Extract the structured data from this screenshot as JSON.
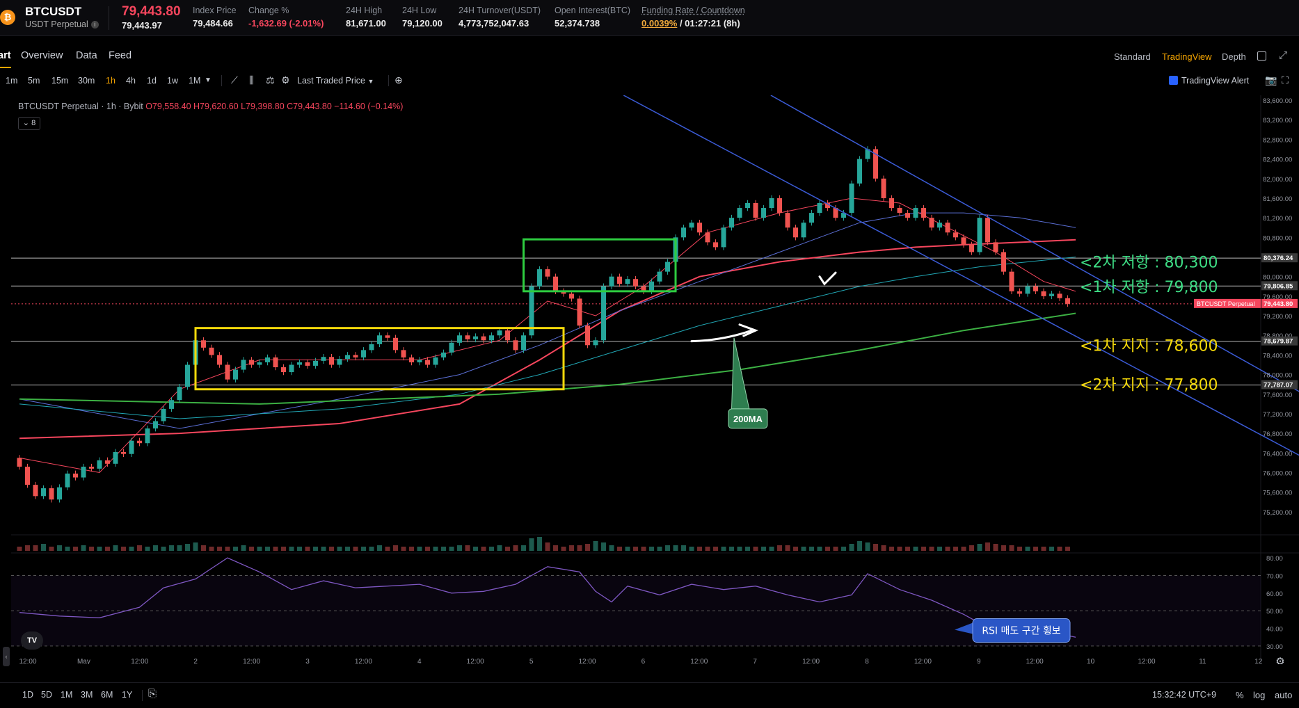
{
  "ticker": {
    "coin_icon": "bitcoin-icon",
    "symbol": "BTCUSDT",
    "contract_type": "USDT Perpetual",
    "last_price": "79,443.80",
    "mark_price": "79,443.97",
    "stats": [
      {
        "label": "Index Price",
        "value": "79,484.66",
        "tone": "normal"
      },
      {
        "label": "Change %",
        "value": "-1,632.69 (-2.01%)",
        "tone": "negative"
      },
      {
        "label": "24H High",
        "value": "81,671.00",
        "tone": "normal"
      },
      {
        "label": "24H Low",
        "value": "79,120.00",
        "tone": "normal"
      },
      {
        "label": "24H Turnover(USDT)",
        "value": "4,773,752,047.63",
        "tone": "normal"
      },
      {
        "label": "Open Interest(BTC)",
        "value": "52,374.738",
        "tone": "normal"
      }
    ],
    "funding": {
      "label": "Funding Rate / Countdown",
      "rate": "0.0039%",
      "countdown": "/ 01:27:21 (8h)"
    }
  },
  "nav": {
    "tabs": [
      "art",
      "Overview",
      "Data",
      "Feed"
    ],
    "views": [
      "Standard",
      "TradingView",
      "Depth"
    ],
    "active_view": "TradingView"
  },
  "toolbar": {
    "timeframes": [
      "1m",
      "5m",
      "15m",
      "30m",
      "1h",
      "4h",
      "1d",
      "1w",
      "1M"
    ],
    "active_timeframe": "1h",
    "price_source": "Last Traded Price",
    "alert_label": "TradingView Alert"
  },
  "legend": {
    "title": "BTCUSDT Perpetual · 1h · Bybit",
    "ohlc": "O79,558.40 H79,620.60 L79,398.80 C79,443.80 −114.60 (−0.14%)",
    "collapse_count": "8"
  },
  "chart_data": {
    "type": "candlestick",
    "price_axis": {
      "ylim": [
        74900,
        83700
      ],
      "ticks": [
        "83,600.00",
        "83,200.00",
        "82,800.00",
        "82,400.00",
        "82,000.00",
        "81,600.00",
        "81,200.00",
        "80,800.00",
        "80,400.00",
        "80,000.00",
        "79,600.00",
        "79,200.00",
        "78,800.00",
        "78,400.00",
        "78,000.00",
        "77,600.00",
        "77,200.00",
        "76,800.00",
        "76,400.00",
        "76,000.00",
        "75,600.00",
        "75,200.00"
      ]
    },
    "price_labels": [
      {
        "text": "80,376.24",
        "value": 80376.24,
        "color": "#3a3a3a"
      },
      {
        "text": "79,806.85",
        "value": 79806.85,
        "color": "#3a3a3a"
      },
      {
        "text": "79,443.80",
        "value": 79443.8,
        "color": "#f6465d",
        "tag": "BTCUSDT Perpetual"
      },
      {
        "text": "78,679.87",
        "value": 78679.87,
        "color": "#3a3a3a"
      },
      {
        "text": "77,787.07",
        "value": 77787.07,
        "color": "#3a3a3a"
      }
    ],
    "x_axis": {
      "start": "Apr 30 08:00",
      "bar_interval_hours": 1,
      "ticks": [
        "12:00",
        "May",
        "12:00",
        "2",
        "12:00",
        "3",
        "12:00",
        "4",
        "12:00",
        "5",
        "12:00",
        "6",
        "12:00",
        "7",
        "12:00",
        "8",
        "12:00",
        "9",
        "12:00",
        "10",
        "12:00",
        "11",
        "12"
      ]
    },
    "candles": [
      [
        76300,
        76120
      ],
      [
        76120,
        75750
      ],
      [
        75750,
        75520
      ],
      [
        75520,
        75680
      ],
      [
        75680,
        75450
      ],
      [
        75450,
        75700
      ],
      [
        75700,
        75980
      ],
      [
        75980,
        75900
      ],
      [
        75900,
        76120
      ],
      [
        76120,
        76080
      ],
      [
        76080,
        76250
      ],
      [
        76250,
        76180
      ],
      [
        76180,
        76420
      ],
      [
        76420,
        76380
      ],
      [
        76380,
        76650
      ],
      [
        76650,
        76600
      ],
      [
        76600,
        76900
      ],
      [
        76900,
        77050
      ],
      [
        77050,
        77300
      ],
      [
        77300,
        77480
      ],
      [
        77480,
        77750
      ],
      [
        77750,
        78200
      ],
      [
        78200,
        78700
      ],
      [
        78700,
        78550
      ],
      [
        78550,
        78400
      ],
      [
        78400,
        78200
      ],
      [
        78200,
        77900
      ],
      [
        77900,
        78100
      ],
      [
        78100,
        78300
      ],
      [
        78300,
        78200
      ],
      [
        78200,
        78250
      ],
      [
        78250,
        78350
      ],
      [
        78350,
        78150
      ],
      [
        78150,
        78050
      ],
      [
        78050,
        78200
      ],
      [
        78200,
        78250
      ],
      [
        78250,
        78180
      ],
      [
        78180,
        78280
      ],
      [
        78280,
        78360
      ],
      [
        78360,
        78200
      ],
      [
        78200,
        78320
      ],
      [
        78320,
        78400
      ],
      [
        78400,
        78350
      ],
      [
        78350,
        78500
      ],
      [
        78500,
        78620
      ],
      [
        78620,
        78800
      ],
      [
        78800,
        78750
      ],
      [
        78750,
        78500
      ],
      [
        78500,
        78350
      ],
      [
        78350,
        78250
      ],
      [
        78250,
        78300
      ],
      [
        78300,
        78200
      ],
      [
        78200,
        78350
      ],
      [
        78350,
        78450
      ],
      [
        78450,
        78650
      ],
      [
        78650,
        78800
      ],
      [
        78800,
        78720
      ],
      [
        78720,
        78780
      ],
      [
        78780,
        78700
      ],
      [
        78700,
        78800
      ],
      [
        78800,
        78900
      ],
      [
        78900,
        78700
      ],
      [
        78700,
        78500
      ],
      [
        78500,
        78800
      ],
      [
        78800,
        79800
      ],
      [
        79800,
        80150
      ],
      [
        80150,
        80000
      ],
      [
        80000,
        79700
      ],
      [
        79700,
        79650
      ],
      [
        79650,
        79550
      ],
      [
        79550,
        79000
      ],
      [
        79000,
        78600
      ],
      [
        78600,
        78700
      ],
      [
        78700,
        79800
      ],
      [
        79800,
        80000
      ],
      [
        80000,
        79850
      ],
      [
        79850,
        79950
      ],
      [
        79950,
        79800
      ],
      [
        79800,
        79700
      ],
      [
        79700,
        79900
      ],
      [
        79900,
        80100
      ],
      [
        80100,
        80300
      ],
      [
        80300,
        80800
      ],
      [
        80800,
        81000
      ],
      [
        81000,
        81100
      ],
      [
        81100,
        80900
      ],
      [
        80900,
        80700
      ],
      [
        80700,
        80600
      ],
      [
        80600,
        81000
      ],
      [
        81000,
        81200
      ],
      [
        81200,
        81400
      ],
      [
        81400,
        81500
      ],
      [
        81500,
        81200
      ],
      [
        81200,
        81400
      ],
      [
        81400,
        81600
      ],
      [
        81600,
        81300
      ],
      [
        81300,
        81000
      ],
      [
        81000,
        80800
      ],
      [
        80800,
        81100
      ],
      [
        81100,
        81300
      ],
      [
        81300,
        81500
      ],
      [
        81500,
        81400
      ],
      [
        81400,
        81200
      ],
      [
        81200,
        81300
      ],
      [
        81300,
        81900
      ],
      [
        81900,
        82400
      ],
      [
        82400,
        82600
      ],
      [
        82600,
        82000
      ],
      [
        82000,
        81600
      ],
      [
        81600,
        81400
      ],
      [
        81400,
        81300
      ],
      [
        81300,
        81200
      ],
      [
        81200,
        81400
      ],
      [
        81400,
        81200
      ],
      [
        81200,
        81000
      ],
      [
        81000,
        81100
      ],
      [
        81100,
        80900
      ],
      [
        80900,
        80800
      ],
      [
        80800,
        80650
      ],
      [
        80650,
        80500
      ],
      [
        80500,
        81200
      ],
      [
        81200,
        80700
      ],
      [
        80700,
        80500
      ],
      [
        80500,
        80100
      ],
      [
        80100,
        79700
      ],
      [
        79700,
        79650
      ],
      [
        79650,
        79800
      ],
      [
        79800,
        79700
      ],
      [
        79700,
        79600
      ],
      [
        79600,
        79650
      ],
      [
        79650,
        79560
      ],
      [
        79560,
        79443.8
      ]
    ],
    "moving_averages": [
      {
        "name": "",
        "color": "#f6465d",
        "width": 2,
        "points": [
          [
            0,
            76700
          ],
          [
            20,
            76800
          ],
          [
            40,
            77000
          ],
          [
            55,
            77400
          ],
          [
            65,
            78300
          ],
          [
            75,
            79300
          ],
          [
            85,
            80000
          ],
          [
            95,
            80300
          ],
          [
            105,
            80500
          ],
          [
            112,
            80600
          ],
          [
            118,
            80650
          ],
          [
            125,
            80700
          ],
          [
            132,
            80750
          ]
        ]
      },
      {
        "name": "",
        "color": "#5b6fd6",
        "width": 1,
        "points": [
          [
            0,
            77500
          ],
          [
            20,
            76900
          ],
          [
            40,
            77500
          ],
          [
            55,
            78000
          ],
          [
            65,
            78600
          ],
          [
            75,
            79300
          ],
          [
            85,
            79900
          ],
          [
            95,
            80500
          ],
          [
            105,
            81100
          ],
          [
            112,
            81300
          ],
          [
            118,
            81300
          ],
          [
            125,
            81200
          ],
          [
            132,
            81000
          ]
        ]
      },
      {
        "name": "",
        "color": "#21a7b5",
        "width": 1,
        "points": [
          [
            0,
            77400
          ],
          [
            20,
            77100
          ],
          [
            40,
            77300
          ],
          [
            55,
            77600
          ],
          [
            65,
            78000
          ],
          [
            75,
            78500
          ],
          [
            85,
            79000
          ],
          [
            95,
            79400
          ],
          [
            105,
            79800
          ],
          [
            112,
            80000
          ],
          [
            120,
            80200
          ],
          [
            132,
            80400
          ]
        ]
      },
      {
        "name": "",
        "color": "#f6465d",
        "width": 1,
        "points": [
          [
            0,
            76300
          ],
          [
            10,
            76000
          ],
          [
            20,
            77700
          ],
          [
            30,
            78300
          ],
          [
            40,
            78300
          ],
          [
            50,
            78300
          ],
          [
            60,
            78700
          ],
          [
            66,
            79500
          ],
          [
            72,
            79200
          ],
          [
            78,
            79800
          ],
          [
            86,
            80900
          ],
          [
            95,
            81300
          ],
          [
            104,
            81600
          ],
          [
            110,
            81500
          ],
          [
            116,
            81000
          ],
          [
            122,
            80500
          ],
          [
            128,
            79900
          ],
          [
            132,
            79700
          ]
        ]
      },
      {
        "name": "",
        "color": "#3cb043",
        "width": 2,
        "points": [
          [
            0,
            77500
          ],
          [
            30,
            77400
          ],
          [
            60,
            77600
          ],
          [
            75,
            77800
          ],
          [
            90,
            78100
          ],
          [
            105,
            78500
          ],
          [
            118,
            78900
          ],
          [
            132,
            79250
          ]
        ]
      }
    ],
    "horizontal_levels": [
      80376.24,
      79806.85,
      78679.87,
      77787.07
    ],
    "trend_lines": [
      {
        "color": "#3b5bd6",
        "from": [
          75.5,
          83700
        ],
        "to": [
          175.5,
          75000
        ]
      },
      {
        "color": "#3b5bd6",
        "from": [
          93.9,
          83700
        ],
        "to": [
          178,
          76000
        ]
      }
    ],
    "annotations": {
      "levels": [
        {
          "text": "<2차 저항 : 80,300",
          "value": 80300,
          "color": "#3ddc84"
        },
        {
          "text": "<1차 저항 : 79,800",
          "value": 79800,
          "color": "#3ddc84"
        },
        {
          "text": "<1차 지지 : 78,600",
          "value": 78600,
          "color": "#f5d90a"
        },
        {
          "text": "<2차 지지 : 77,800",
          "value": 77800,
          "color": "#f5d90a"
        }
      ],
      "callout_ma": "200MA",
      "callout_rsi": "RSI 매도 구간 횡보",
      "boxes": [
        {
          "color": "#f5d90a",
          "x": [
            22,
            68
          ],
          "y": [
            77700,
            78950
          ]
        },
        {
          "color": "#2ecc40",
          "x": [
            63,
            82
          ],
          "y": [
            79700,
            80760
          ]
        }
      ]
    },
    "rsi": {
      "ylim": [
        28,
        82
      ],
      "ticks": [
        "80.00",
        "70.00",
        "60.00",
        "50.00",
        "40.00",
        "30.00"
      ],
      "bands": [
        70,
        50,
        30
      ],
      "points": [
        [
          0,
          49
        ],
        [
          5,
          47
        ],
        [
          10,
          46
        ],
        [
          15,
          52
        ],
        [
          18,
          63
        ],
        [
          22,
          68
        ],
        [
          26,
          80
        ],
        [
          30,
          72
        ],
        [
          34,
          62
        ],
        [
          38,
          67
        ],
        [
          42,
          63
        ],
        [
          46,
          64
        ],
        [
          50,
          65
        ],
        [
          54,
          60
        ],
        [
          58,
          61
        ],
        [
          62,
          65
        ],
        [
          66,
          75
        ],
        [
          70,
          72
        ],
        [
          72,
          61
        ],
        [
          74,
          55
        ],
        [
          76,
          64
        ],
        [
          80,
          59
        ],
        [
          84,
          65
        ],
        [
          88,
          62
        ],
        [
          92,
          64
        ],
        [
          96,
          59
        ],
        [
          100,
          55
        ],
        [
          104,
          59
        ],
        [
          106,
          71
        ],
        [
          110,
          62
        ],
        [
          114,
          56
        ],
        [
          118,
          48
        ],
        [
          122,
          38
        ],
        [
          126,
          32
        ],
        [
          130,
          37
        ],
        [
          132,
          35
        ]
      ]
    },
    "volume": {
      "heights": [
        3,
        4,
        4,
        5,
        3,
        4,
        3,
        3,
        4,
        3,
        3,
        3,
        4,
        3,
        3,
        4,
        3,
        4,
        3,
        4,
        4,
        5,
        6,
        4,
        3,
        3,
        3,
        3,
        4,
        3,
        3,
        3,
        3,
        3,
        3,
        3,
        3,
        3,
        3,
        3,
        3,
        3,
        3,
        3,
        3,
        4,
        3,
        4,
        3,
        3,
        3,
        3,
        3,
        3,
        3,
        4,
        4,
        3,
        3,
        3,
        4,
        3,
        4,
        4,
        9,
        10,
        6,
        4,
        3,
        4,
        4,
        5,
        7,
        6,
        4,
        3,
        3,
        3,
        3,
        3,
        3,
        4,
        4,
        4,
        3,
        3,
        3,
        3,
        3,
        3,
        3,
        3,
        3,
        3,
        3,
        4,
        4,
        3,
        3,
        3,
        3,
        3,
        3,
        3,
        5,
        7,
        6,
        5,
        4,
        3,
        3,
        3,
        3,
        3,
        3,
        3,
        3,
        3,
        3,
        4,
        5,
        6,
        5,
        4,
        4,
        3,
        3,
        3,
        3,
        3,
        3,
        3
      ]
    }
  },
  "bottom": {
    "ranges": [
      "1D",
      "5D",
      "1M",
      "3M",
      "6M",
      "1Y"
    ],
    "clock": "15:32:42 UTC+9",
    "options": [
      "%",
      "log",
      "auto"
    ]
  },
  "brand": {
    "tv_logo": "TV"
  }
}
